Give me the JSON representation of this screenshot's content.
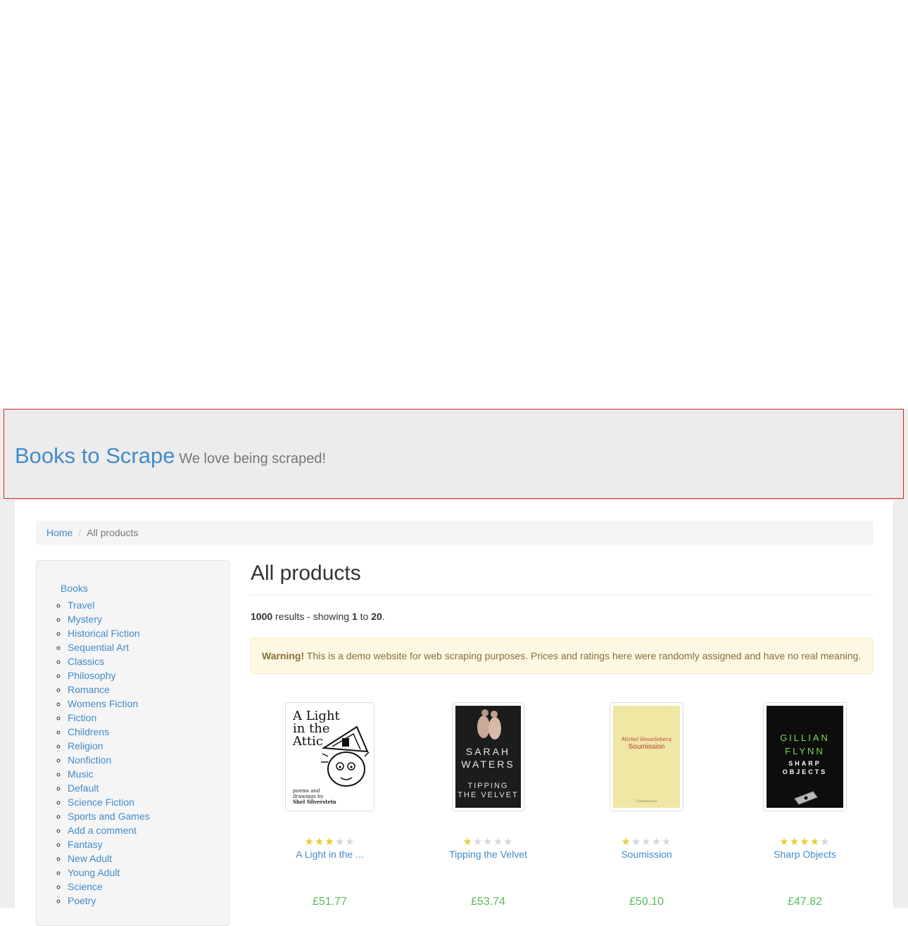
{
  "header": {
    "brand_title": "Books to Scrape",
    "brand_tagline": "We love being scraped!"
  },
  "breadcrumb": {
    "home": "Home",
    "separator": "/",
    "current": "All products"
  },
  "sidebar": {
    "root_label": "Books",
    "categories": [
      "Travel",
      "Mystery",
      "Historical Fiction",
      "Sequential Art",
      "Classics",
      "Philosophy",
      "Romance",
      "Womens Fiction",
      "Fiction",
      "Childrens",
      "Religion",
      "Nonfiction",
      "Music",
      "Default",
      "Science Fiction",
      "Sports and Games",
      "Add a comment",
      "Fantasy",
      "New Adult",
      "Young Adult",
      "Science",
      "Poetry"
    ]
  },
  "main": {
    "title": "All products",
    "results": {
      "total": "1000",
      "text1": " results - showing ",
      "from": "1",
      "text2": " to ",
      "to": "20",
      "text3": "."
    },
    "warning": {
      "label": "Warning!",
      "text": " This is a demo website for web scraping purposes. Prices and ratings here were randomly assigned and have no real meaning."
    }
  },
  "products": [
    {
      "title": "A Light in the ...",
      "price": "£51.77",
      "rating": 3,
      "cover_text": [
        "A Light",
        "in the",
        "Attic",
        "poems and",
        "drawings by",
        "Shel Silverstein"
      ]
    },
    {
      "title": "Tipping the Velvet",
      "price": "£53.74",
      "rating": 1,
      "cover_text": [
        "SARAH",
        "WATERS",
        "TIPPING",
        "THE VELVET"
      ]
    },
    {
      "title": "Soumission",
      "price": "£50.10",
      "rating": 1,
      "cover_text": [
        "Michel Houellebecq",
        "Soumission",
        "Flammarion"
      ]
    },
    {
      "title": "Sharp Objects",
      "price": "£47.82",
      "rating": 4,
      "cover_text": [
        "GILLIAN",
        "FLYNN",
        "SHARP",
        "OBJECTS"
      ]
    }
  ],
  "colors": {
    "link": "#428bca",
    "price": "#5cb85c",
    "star_on": "#e6ce31",
    "star_off": "#d7d7d7",
    "warning_bg": "#fcf8e3",
    "warning_text": "#8a6d3b"
  }
}
